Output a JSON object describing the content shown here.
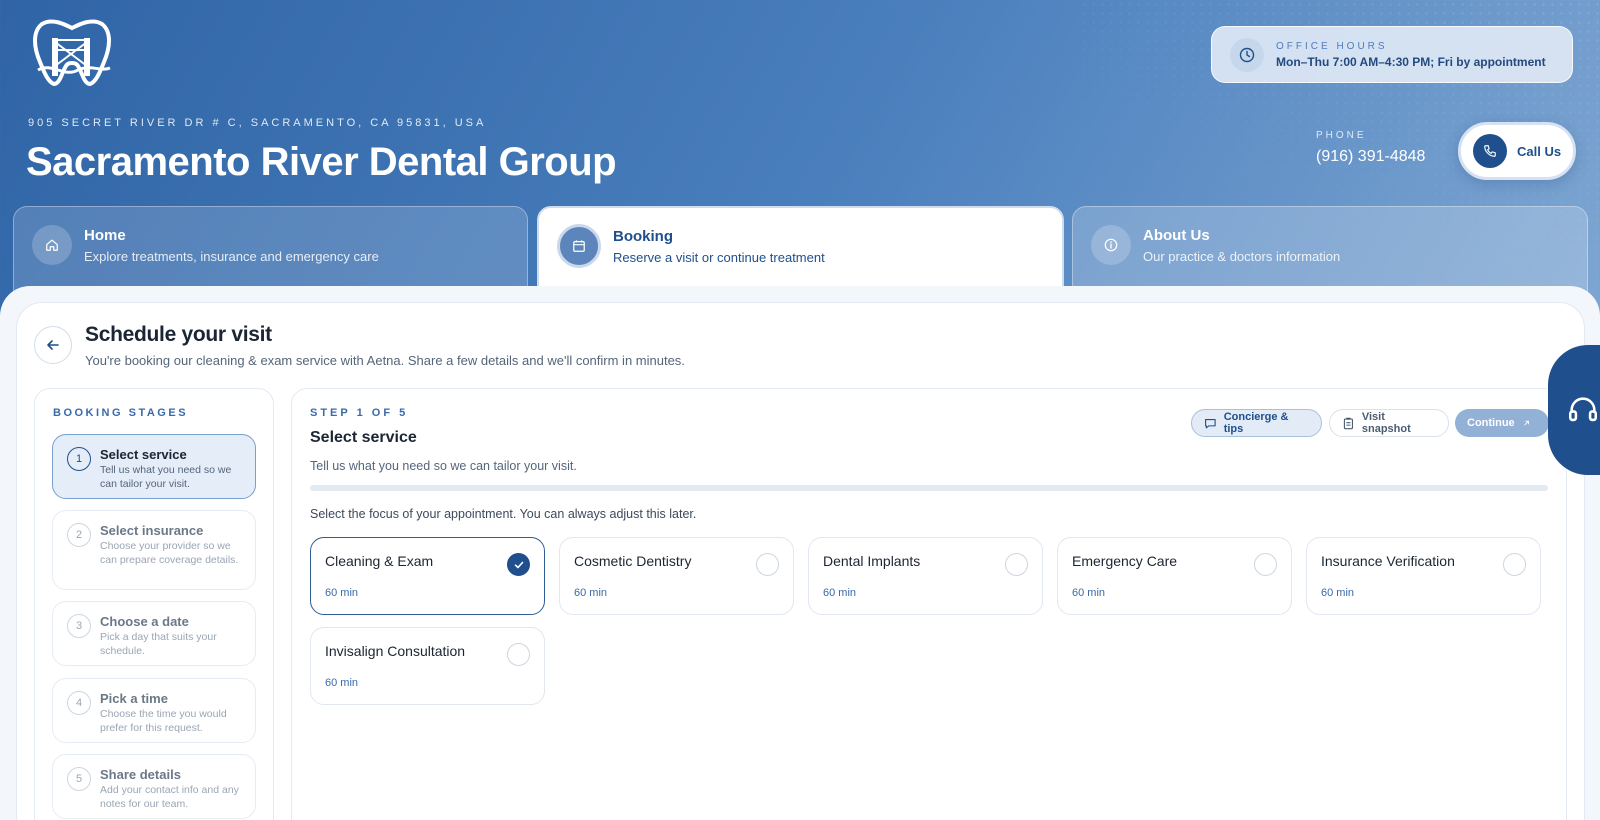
{
  "header": {
    "address": "905 SECRET RIVER DR # C, SACRAMENTO, CA 95831, USA",
    "practice_name": "Sacramento River Dental Group",
    "office_hours_label": "OFFICE HOURS",
    "office_hours_text": "Mon–Thu 7:00 AM–4:30 PM; Fri by appointment",
    "phone_label": "PHONE",
    "phone_number": "(916) 391-4848",
    "call_label": "Call Us"
  },
  "tabs": [
    {
      "title": "Home",
      "subtitle": "Explore treatments, insurance and emergency care",
      "icon": "home-icon"
    },
    {
      "title": "Booking",
      "subtitle": "Reserve a visit or continue treatment",
      "icon": "calendar-icon"
    },
    {
      "title": "About Us",
      "subtitle": "Our practice & doctors information",
      "icon": "info-icon"
    }
  ],
  "page": {
    "title": "Schedule your visit",
    "subtitle": "You're booking our cleaning & exam service with Aetna. Share a few details and we'll confirm in minutes."
  },
  "stages": {
    "label": "BOOKING STAGES",
    "items": [
      {
        "num": "1",
        "title": "Select service",
        "desc": "Tell us what you need so we can tailor your visit."
      },
      {
        "num": "2",
        "title": "Select insurance",
        "desc": "Choose your provider so we can prepare coverage details."
      },
      {
        "num": "3",
        "title": "Choose a date",
        "desc": "Pick a day that suits your schedule."
      },
      {
        "num": "4",
        "title": "Pick a time",
        "desc": "Choose the time you would prefer for this request."
      },
      {
        "num": "5",
        "title": "Share details",
        "desc": "Add your contact info and any notes for our team."
      }
    ],
    "active_index": 0
  },
  "step": {
    "label": "STEP 1 OF 5",
    "title": "Select service",
    "subtitle": "Tell us what you need so we can tailor your visit.",
    "focus_text": "Select the focus of your appointment. You can always adjust this later.",
    "progress_fraction": 0.0
  },
  "actions": {
    "concierge": "Concierge & tips",
    "snapshot": "Visit snapshot",
    "continue": "Continue"
  },
  "services": [
    {
      "name": "Cleaning & Exam",
      "duration": "60 min",
      "selected": true
    },
    {
      "name": "Cosmetic Dentistry",
      "duration": "60 min",
      "selected": false
    },
    {
      "name": "Dental Implants",
      "duration": "60 min",
      "selected": false
    },
    {
      "name": "Emergency Care",
      "duration": "60 min",
      "selected": false
    },
    {
      "name": "Insurance Verification",
      "duration": "60 min",
      "selected": false
    },
    {
      "name": "Invisalign Consultation",
      "duration": "60 min",
      "selected": false
    }
  ],
  "colors": {
    "brand": "#1f4f8c",
    "accent": "#3a6aa8",
    "header_gradient_start": "#2f64a6",
    "header_gradient_end": "#8fb3d9"
  }
}
